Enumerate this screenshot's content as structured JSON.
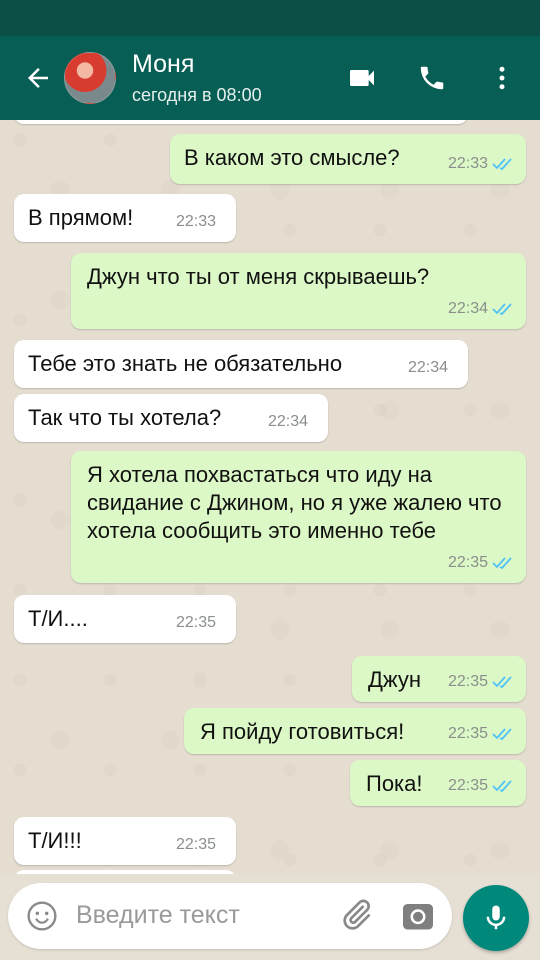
{
  "header": {
    "contact_name": "Моня",
    "last_seen": "сегодня в 08:00"
  },
  "icons": {
    "back": "arrow-left-icon",
    "video": "video-camera-icon",
    "call": "phone-icon",
    "menu": "more-vert-icon",
    "emoji": "smiley-icon",
    "attach": "paperclip-icon",
    "camera": "camera-icon",
    "mic": "microphone-icon"
  },
  "colors": {
    "appbar": "#075e54",
    "outgoing_bubble": "#dcf8c6",
    "incoming_bubble": "#ffffff",
    "read_ticks": "#4fc3f7",
    "mic_button": "#00897b"
  },
  "messages": [
    {
      "direction": "out",
      "text": "В каком это смысле?",
      "time": "22:33",
      "read": true
    },
    {
      "direction": "in",
      "text": "В прямом!",
      "time": "22:33"
    },
    {
      "direction": "out",
      "text": "Джун что ты от меня скрываешь?",
      "time": "22:34",
      "read": true
    },
    {
      "direction": "in",
      "text": "Тебе это знать не обязательно",
      "time": "22:34"
    },
    {
      "direction": "in",
      "text": "Так что ты хотела?",
      "time": "22:34"
    },
    {
      "direction": "out",
      "text": "Я хотела похвастаться что иду на свидание с Джином, но я уже жалею что хотела сообщить это именно тебе",
      "time": "22:35",
      "read": true
    },
    {
      "direction": "in",
      "text": "Т/И....",
      "time": "22:35"
    },
    {
      "direction": "out",
      "text": "Джун",
      "time": "22:35",
      "read": true
    },
    {
      "direction": "out",
      "text": "Я пойду готовиться!",
      "time": "22:35",
      "read": true
    },
    {
      "direction": "out",
      "text": "Пока!",
      "time": "22:35",
      "read": true
    },
    {
      "direction": "in",
      "text": "Т/И!!!",
      "time": "22:35"
    }
  ],
  "composer": {
    "placeholder": "Введите текст"
  }
}
